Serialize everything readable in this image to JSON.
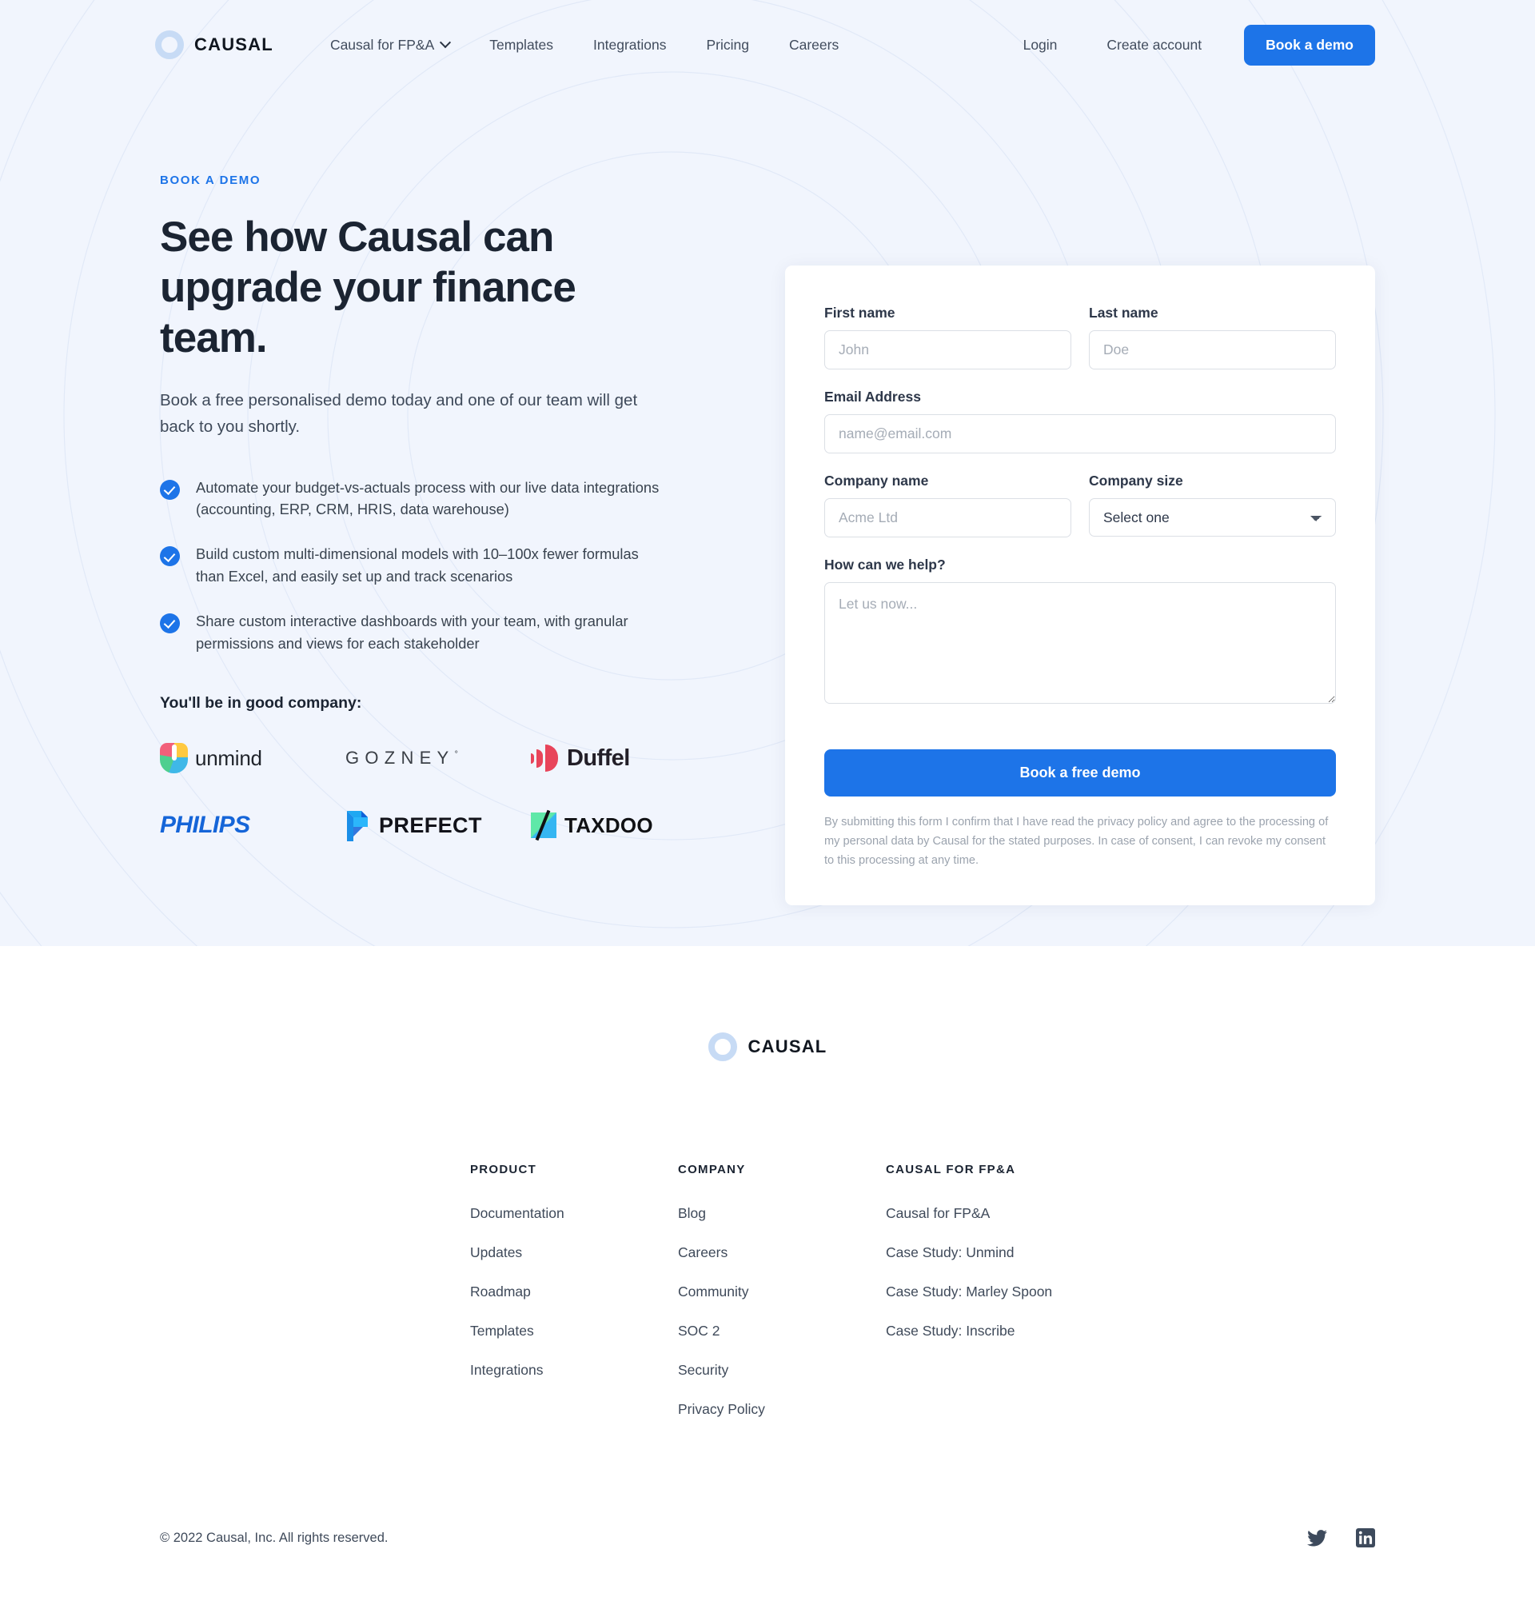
{
  "brand": {
    "name": "CAUSAL",
    "logo_icon": "causal-ring-logo",
    "ring_color": "#c7dbf5"
  },
  "colors": {
    "accent": "#1d74e8",
    "hero_bg": "#f1f5fd",
    "heading": "#1b2432",
    "body_text": "#3f4a5a"
  },
  "nav": {
    "links": [
      {
        "label": "Causal for FP&A",
        "has_dropdown": true
      },
      {
        "label": "Templates",
        "has_dropdown": false
      },
      {
        "label": "Integrations",
        "has_dropdown": false
      },
      {
        "label": "Pricing",
        "has_dropdown": false
      },
      {
        "label": "Careers",
        "has_dropdown": false
      }
    ],
    "login_label": "Login",
    "create_account_label": "Create account",
    "demo_button_label": "Book a demo"
  },
  "hero": {
    "eyebrow": "BOOK A DEMO",
    "title": "See how Causal can upgrade your finance team.",
    "subtitle": "Book a free personalised demo today and one of our team will get back to you shortly.",
    "bullets": [
      "Automate your budget-vs-actuals process with our live data integrations (accounting, ERP, CRM, HRIS, data warehouse)",
      "Build custom multi-dimensional models with 10–100x fewer formulas than Excel, and easily set up and track scenarios",
      "Share custom interactive dashboards with your team, with granular permissions and views for each stakeholder"
    ],
    "social_proof_title": "You'll be in good company:",
    "logos": [
      {
        "name": "unmind",
        "label": "unmind"
      },
      {
        "name": "gozney",
        "label": "GOZNEY"
      },
      {
        "name": "duffel",
        "label": "Duffel"
      },
      {
        "name": "philips",
        "label": "PHILIPS"
      },
      {
        "name": "prefect",
        "label": "PREFECT"
      },
      {
        "name": "taxdoo",
        "label": "TAXDOO"
      }
    ]
  },
  "form": {
    "first_name": {
      "label": "First name",
      "placeholder": "John",
      "value": ""
    },
    "last_name": {
      "label": "Last name",
      "placeholder": "Doe",
      "value": ""
    },
    "email": {
      "label": "Email Address",
      "placeholder": "name@email.com",
      "value": ""
    },
    "company_name": {
      "label": "Company name",
      "placeholder": "Acme Ltd",
      "value": ""
    },
    "company_size": {
      "label": "Company size",
      "selected": "Select one",
      "options": [
        "Select one"
      ]
    },
    "message": {
      "label": "How can we help?",
      "placeholder": "Let us now...",
      "value": ""
    },
    "submit_label": "Book a free demo",
    "disclaimer": "By submitting this form I confirm that I have read the privacy policy and agree to the processing of my personal data by Causal for the stated purposes. In case of consent, I can revoke my consent to this processing at any time."
  },
  "footer": {
    "logo_label": "CAUSAL",
    "columns": [
      {
        "title": "PRODUCT",
        "links": [
          "Documentation",
          "Updates",
          "Roadmap",
          "Templates",
          "Integrations"
        ]
      },
      {
        "title": "COMPANY",
        "links": [
          "Blog",
          "Careers",
          "Community",
          "SOC 2",
          "Security",
          "Privacy Policy"
        ]
      },
      {
        "title": "CAUSAL FOR FP&A",
        "links": [
          "Causal for FP&A",
          "Case Study: Unmind",
          "Case Study: Marley Spoon",
          "Case Study: Inscribe"
        ]
      }
    ],
    "copyright": "© 2022 Causal, Inc. All rights reserved.",
    "socials": [
      {
        "name": "twitter-icon"
      },
      {
        "name": "linkedin-icon"
      }
    ]
  }
}
